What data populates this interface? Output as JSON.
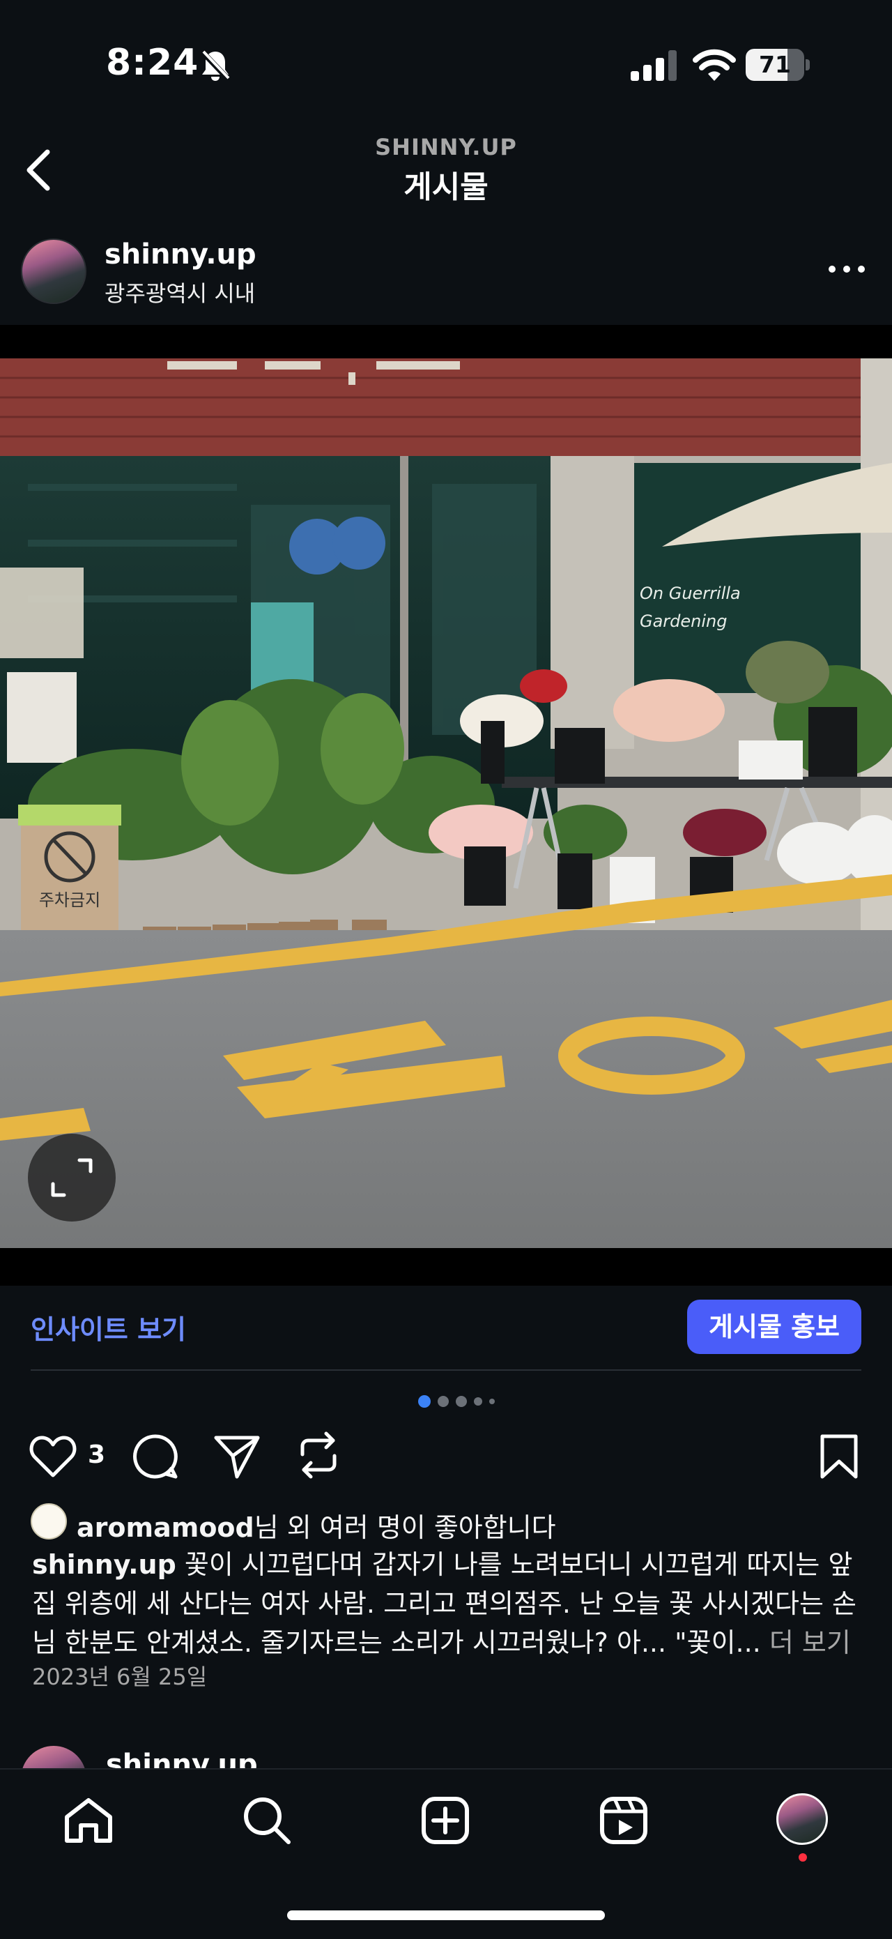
{
  "status_bar": {
    "time": "8:24",
    "battery": "71",
    "battery_level": 0.71,
    "icons": [
      "bell-off-icon",
      "signal-icon",
      "wifi-icon",
      "battery-icon"
    ]
  },
  "header": {
    "username": "SHINNY.UP",
    "title": "게시물",
    "back_icon": "chevron-left-icon"
  },
  "post": {
    "author": {
      "username": "shinny.up",
      "location": "광주광역시 시내"
    },
    "more_icon": "ellipsis-icon",
    "photo": {
      "description_icon": "storefront-photo",
      "sign_text": "On Guerrilla Gardening",
      "no_parking_sign": "주차금지",
      "expand_icon": "expand-icon"
    },
    "insights_label": "인사이트 보기",
    "promote_label": "게시물 홍보",
    "carousel": {
      "count": 5,
      "active_index": 0
    },
    "actions": {
      "like_count": "3",
      "icons": [
        "heart-icon",
        "comment-icon",
        "share-icon",
        "repost-icon",
        "bookmark-icon"
      ]
    },
    "liked_by": {
      "user": "aromamood",
      "suffix": "님 외 여러 명이 좋아합니다"
    },
    "caption": {
      "user": "shinny.up",
      "text": " 꽃이 시끄럽다며 갑자기 나를 노려보더니 시끄럽게 따지는 앞집 위층에 세 산다는 여자 사람. 그리고 편의점주. 난 오늘 꽃 사시겠다는 손님 한분도 안계셨소. 줄기자르는 소리가 시끄러웠나? 아... \"꽃이... ",
      "more_label": "더 보기"
    },
    "date": "2023년 6월 25일"
  },
  "next_post": {
    "username": "shinny.up"
  },
  "bottom_nav": {
    "items": [
      "home-icon",
      "search-icon",
      "create-icon",
      "reels-icon",
      "profile-avatar"
    ]
  },
  "colors": {
    "background": "#0c1014",
    "accent": "#4a5df9",
    "link": "#6e8cff",
    "secondary_text": "#a8a8a8",
    "notification": "#ff3040"
  }
}
